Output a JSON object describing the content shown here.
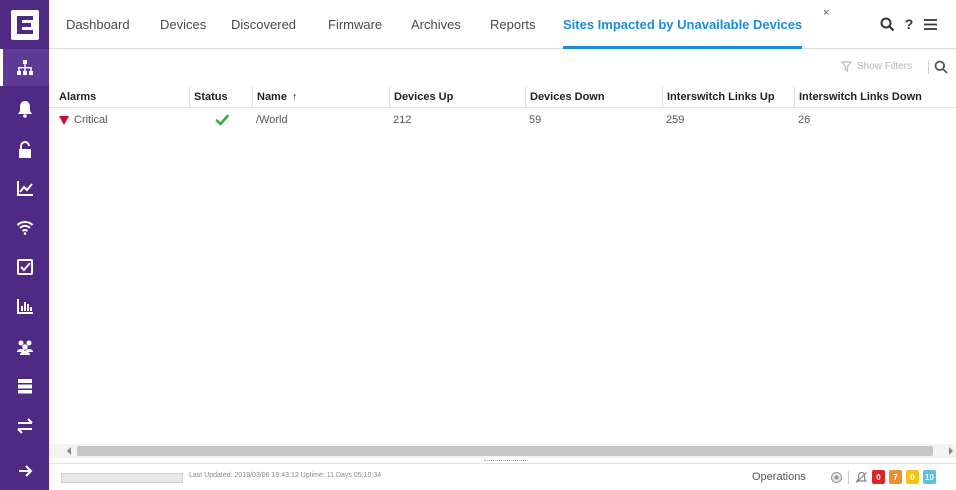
{
  "tabs": [
    {
      "label": "Dashboard"
    },
    {
      "label": "Devices"
    },
    {
      "label": "Discovered"
    },
    {
      "label": "Firmware"
    },
    {
      "label": "Archives"
    },
    {
      "label": "Reports"
    },
    {
      "label": "Sites Impacted by Unavailable Devices"
    }
  ],
  "active_tab_close": "×",
  "top_icons": {
    "help": "?"
  },
  "sidebar": {
    "items": [
      {
        "icon": "network-icon"
      },
      {
        "icon": "bell-icon"
      },
      {
        "icon": "lock-icon"
      },
      {
        "icon": "chart-line-icon"
      },
      {
        "icon": "wifi-icon"
      },
      {
        "icon": "checkbox-icon"
      },
      {
        "icon": "bar-chart-icon"
      },
      {
        "icon": "users-icon"
      },
      {
        "icon": "server-icon"
      },
      {
        "icon": "transfer-icon"
      },
      {
        "icon": "arrow-right-icon"
      }
    ]
  },
  "toolbar": {
    "show_filters": "Show Filters"
  },
  "grid": {
    "columns": [
      "Alarms",
      "Status",
      "Name",
      "Devices Up",
      "Devices Down",
      "Interswitch Links Up",
      "Interswitch Links Down"
    ],
    "sort_indicator": "↑",
    "rows": [
      {
        "alarm": "Critical",
        "status": "ok",
        "name": "/World",
        "devices_up": "212",
        "devices_down": "59",
        "links_up": "259",
        "links_down": "26"
      }
    ]
  },
  "statusbar": {
    "progress": 0.0,
    "text": "Last Updated: 2018/03/06 19:43:12   Uptime: 11 Days 05:10:34",
    "mode": "Operations",
    "badges": [
      {
        "color": "#d9242a",
        "value": "0"
      },
      {
        "color": "#e8912e",
        "value": "7"
      },
      {
        "color": "#f0c419",
        "value": "0"
      },
      {
        "color": "#5bc0de",
        "value": "10"
      }
    ]
  },
  "colors": {
    "sidebar": "#4e2a84",
    "accent": "#1a8fd8",
    "critical": "#c8102e",
    "ok": "#3aa845"
  }
}
